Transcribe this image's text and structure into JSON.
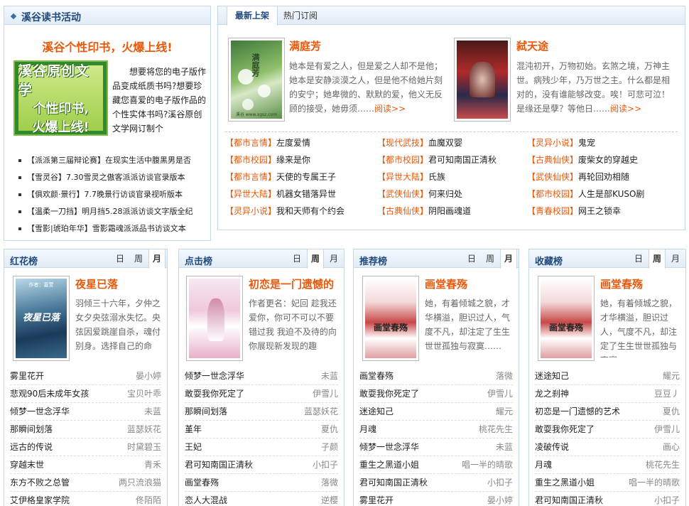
{
  "activity": {
    "title": "溪谷读书活动",
    "headline": "溪谷个性印书，火爆上线!",
    "promo": {
      "line1": "溪谷原创文学",
      "line2": "个性印书,",
      "line3": "火爆上线!"
    },
    "description": "想要将您的电子版作品变成纸质书吗?想要珍藏您喜爱的电子版作品的个性实体书吗?溪谷原创文学网订制个",
    "items": [
      "【派派第三届辩论赛】在现实生活中腹黑男是否",
      "【雪灵谷】7.30雪灵之傲客派派访谈官录版本",
      "【俱欢颜·景行】7.7晚景行访谈官录视听版本",
      "【温柔一刀挡】明月挡5.28派派访谈文字版全纪",
      "【雪影|琥珀年华】雪影霜魂派派品书访谈文本"
    ]
  },
  "newbooks": {
    "tabs": [
      "最新上架",
      "热门订阅"
    ],
    "featured": [
      {
        "title": "满庭芳",
        "desc": "她本是有爱之人，但是爱之人却不是他；她本是安静淡漠之人，但是他不给她片刻的安宁；她卑微的、默默的爱，他义无反顾的接受，她毋须……",
        "more": "阅读>>",
        "cover_text": "满庭芳",
        "cover_site": "溪谷 www.xgsz.com"
      },
      {
        "title": "弑天途",
        "desc": "混沌初开，万物初始。玄煞之境，万神主世。病残少年，乃万世之主。什么都是相对的，没有谁能够改变。唉！可悲可泣！是缘还是孽？等他日……",
        "more": "阅读>>",
        "cover_text": "",
        "cover_site": ""
      }
    ],
    "list": [
      [
        [
          "【都市言情】",
          "左度爱情"
        ],
        [
          "【现代武技】",
          "血魔双婴"
        ],
        [
          "【灵异小说】",
          "鬼宠"
        ]
      ],
      [
        [
          "【都市校园】",
          "缘来是你"
        ],
        [
          "【都市校园】",
          "君可知南国正清秋"
        ],
        [
          "【古典仙侠】",
          "废柴女的穿越史"
        ]
      ],
      [
        [
          "【都市言情】",
          "天使的专属王子"
        ],
        [
          "【异世大陆】",
          "氏族"
        ],
        [
          "【武侠仙侠】",
          "再轮回劝相随"
        ]
      ],
      [
        [
          "【异世大陆】",
          "机器女错落异世"
        ],
        [
          "【武侠仙侠】",
          "何来归处"
        ],
        [
          "【都市校园】",
          "人生是部KUSO剧"
        ]
      ],
      [
        [
          "【灵异小说】",
          "我和天师有个约会"
        ],
        [
          "【古典仙侠】",
          "阴阳画魂道"
        ],
        [
          "【青春校园】",
          "网王之锁幸"
        ]
      ]
    ]
  },
  "rankings": [
    {
      "title": "红花榜",
      "tabs": [
        "日",
        "周",
        "月"
      ],
      "active": 2,
      "feature": {
        "title": "夜星已落",
        "desc": "羽倾三十六年，夕仲之女夕央弦溺水失忆。央弦因爱跳崖自杀，魂付别身。选择自己的命",
        "cover_text": "夜星已落",
        "cover_author": "作者：嘉萱"
      },
      "rows": [
        [
          "雾里花开",
          "晏小婷"
        ],
        [
          "悲观90后未成年女孩",
          "宝贝叶乖"
        ],
        [
          "倾梦一世念浮华",
          "未蓝"
        ],
        [
          "那瞬间划落",
          "蓝瑟妖花"
        ],
        [
          "远古的传说",
          "时黛碧玉"
        ],
        [
          "穿越末世",
          "青禾"
        ],
        [
          "东方不败之总管",
          "两只流浪猫"
        ],
        [
          "艾伊格皇家学院",
          "佟陌陌"
        ]
      ]
    },
    {
      "title": "点击榜",
      "tabs": [
        "日",
        "周",
        "月"
      ],
      "active": 1,
      "feature": {
        "title": "初恋是一门遗憾的",
        "desc": "作者更名：妃回 趁我还爱你，你可不可以不要错过我 我迫不及待的向你展现新发现的趣",
        "cover_text": "",
        "cover_author": ""
      },
      "rows": [
        [
          "倾梦一世念浮华",
          "未蓝"
        ],
        [
          "敢耍我你死定了",
          "伊雪儿"
        ],
        [
          "那瞬间划落",
          "蓝瑟妖花"
        ],
        [
          "堇年",
          "夏仇"
        ],
        [
          "王妃",
          "子颜"
        ],
        [
          "君可知南国正清秋",
          "小扣子"
        ],
        [
          "画堂春殇",
          "落微"
        ],
        [
          "恋人大混战",
          "逆樱"
        ]
      ]
    },
    {
      "title": "推荐榜",
      "tabs": [
        "日",
        "周",
        "月"
      ],
      "active": 2,
      "feature": {
        "title": "画堂春殇",
        "desc": "她，有着倾城之貌，才华横溢，胆识过人，气度不凡，却注定了生生世世孤独与寂寞……",
        "cover_text": "画堂春殇",
        "cover_author": ""
      },
      "rows": [
        [
          "画堂春殇",
          "落微"
        ],
        [
          "敢耍我你死定了",
          "伊雪儿"
        ],
        [
          "迷途知己",
          "耀元"
        ],
        [
          "月魂",
          "桃花先生"
        ],
        [
          "倾梦一世念浮华",
          "未蓝"
        ],
        [
          "重生之黑道小姐",
          "唱一半的晴歌"
        ],
        [
          "君可知南国正清秋",
          "小扣子"
        ],
        [
          "雾里花开",
          "晏小婷"
        ]
      ]
    },
    {
      "title": "收藏榜",
      "tabs": [
        "日",
        "周",
        "月"
      ],
      "active": 1,
      "feature": {
        "title": "画堂春殇",
        "desc": "她，有着倾城之貌，才华横溢，胆识过人，气度不凡，却注定了生生世世孤独与寂寞……",
        "cover_text": "画堂春殇",
        "cover_author": ""
      },
      "rows": [
        [
          "迷途知己",
          "耀元"
        ],
        [
          "龙之刹神",
          "豆豆丿"
        ],
        [
          "初恋是一门遗憾的艺术",
          "夏仇"
        ],
        [
          "敢耍我你死定了",
          "伊雪儿"
        ],
        [
          "凌破传说",
          "画心"
        ],
        [
          "月魂",
          "桃花先生"
        ],
        [
          "重生之黑道小姐",
          "唱一半的晴歌"
        ],
        [
          "君可知南国正清秋",
          "小扣子"
        ]
      ]
    }
  ]
}
